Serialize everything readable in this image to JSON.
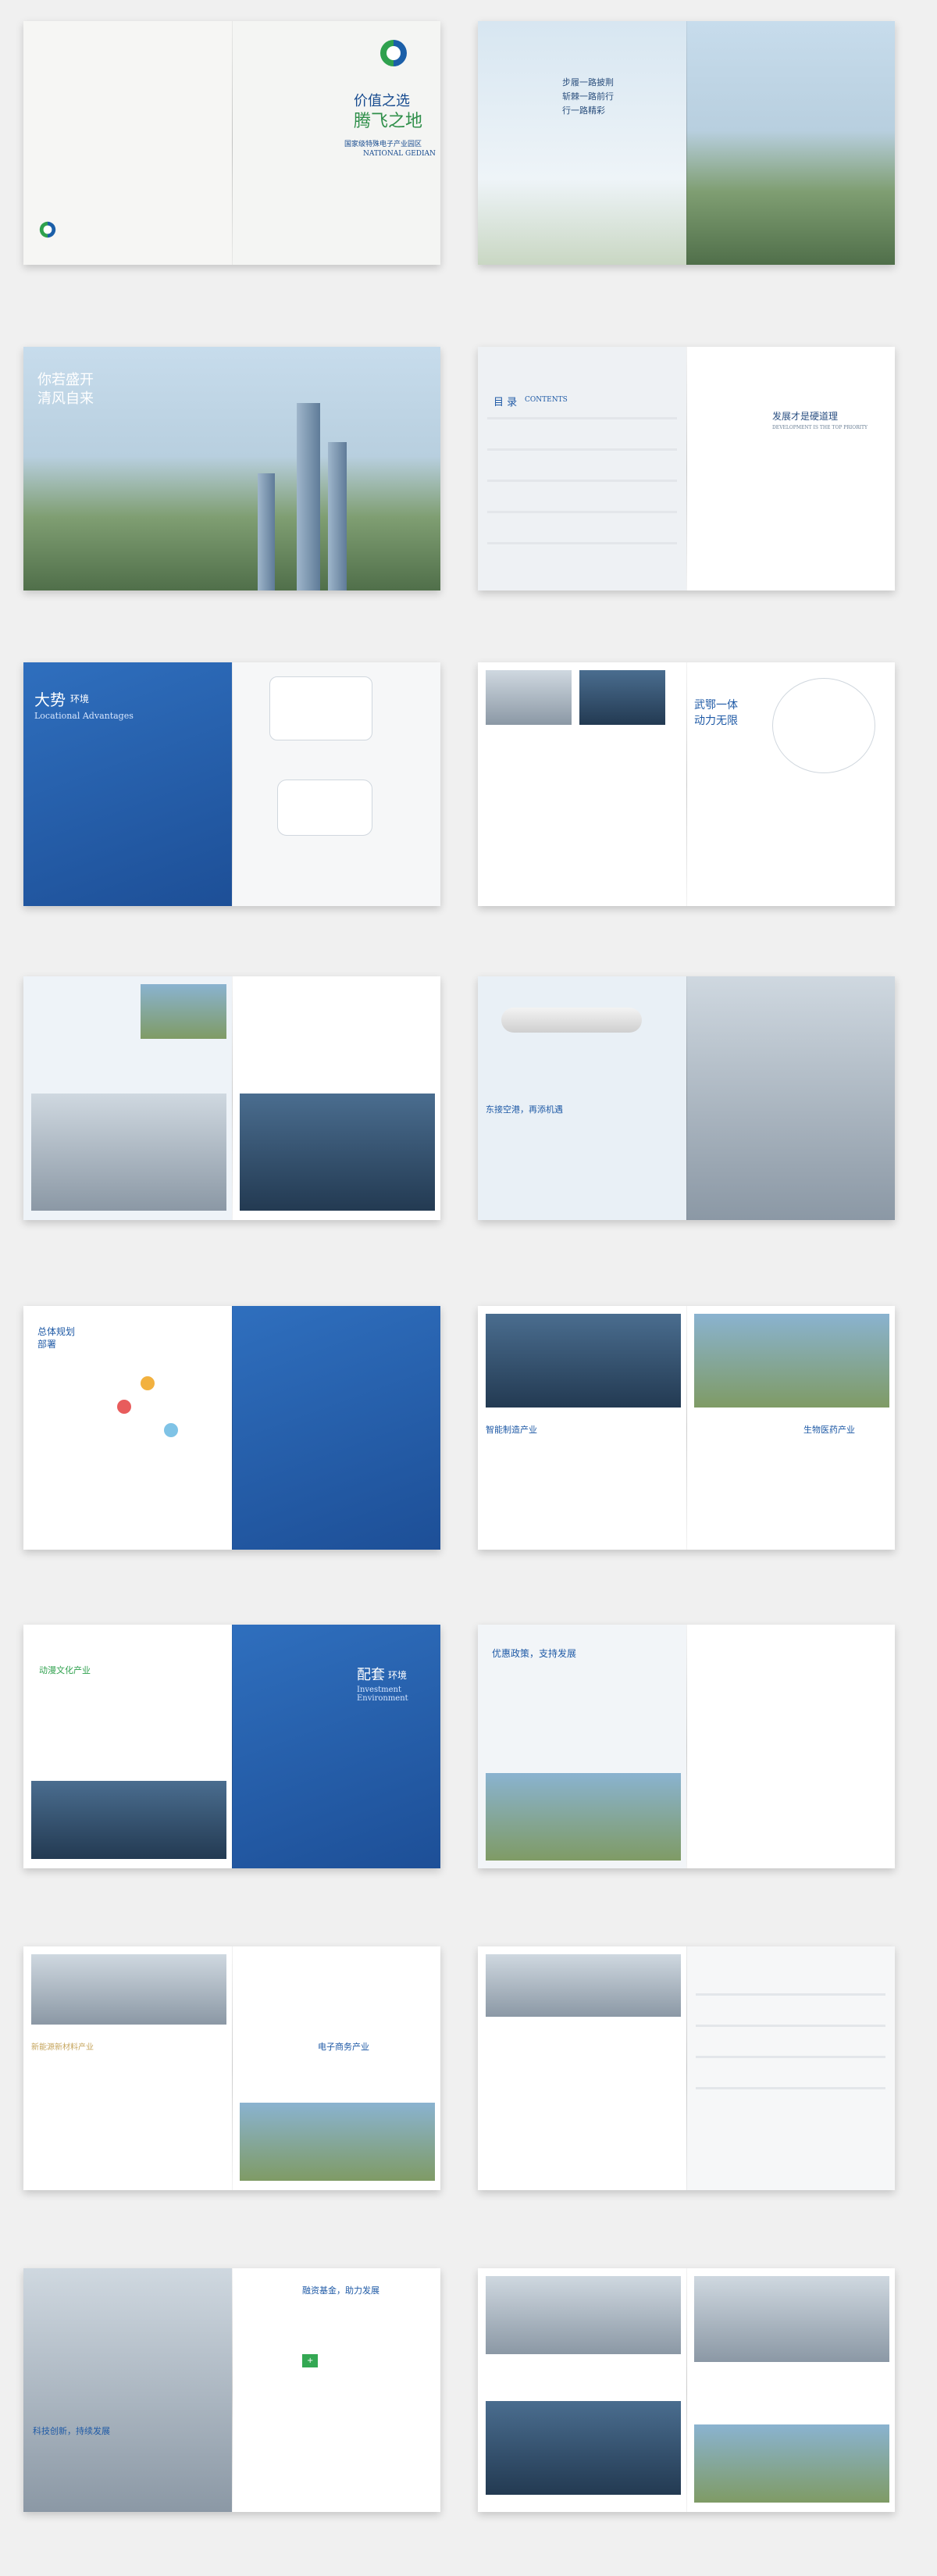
{
  "brand": {
    "slogan_line1": "价值之选",
    "slogan_line2": "腾飞之地",
    "park_name_cn": "国家级特殊电子产业园区",
    "park_name_en": "NATIONAL GEDIAN"
  },
  "spread2": {
    "lines": [
      "步履一路披荆",
      "斩棘一路前行",
      "行一路精彩"
    ]
  },
  "spread3": {
    "headline_1": "你若盛开",
    "headline_2": "清风自来"
  },
  "spread4": {
    "toc_title": "目 录",
    "toc_en": "CONTENTS",
    "right_title": "发展才是硬道理",
    "right_en": "DEVELOPMENT IS THE TOP PRIORITY"
  },
  "spread5": {
    "title_cn": "大势",
    "title_cn_small": "环境",
    "title_en": "Locational Advantages"
  },
  "spread6": {
    "title_1": "武鄂一体",
    "title_2": "动力无限"
  },
  "spread8": {
    "title": "东接空港，再添机遇"
  },
  "spread9": {
    "title": "总体规划",
    "title2": "部署"
  },
  "spread10": {
    "title": "智能制造产业",
    "title2": "生物医药产业"
  },
  "spread11": {
    "title": "动漫文化产业",
    "right_title_1": "配套",
    "right_title_2": "环境",
    "right_en": "Investment Environment"
  },
  "spread12": {
    "title": "优惠政策，支持发展"
  },
  "spread13": {
    "left_title": "新能源新材料产业",
    "right_title": "电子商务产业"
  },
  "spread15": {
    "left_title": "科技创新，持续发展",
    "right_title": "融资基金，助力发展"
  },
  "colors": {
    "primary_blue": "#1f5aa6",
    "accent_green": "#34a853",
    "gold": "#c6a65e"
  }
}
